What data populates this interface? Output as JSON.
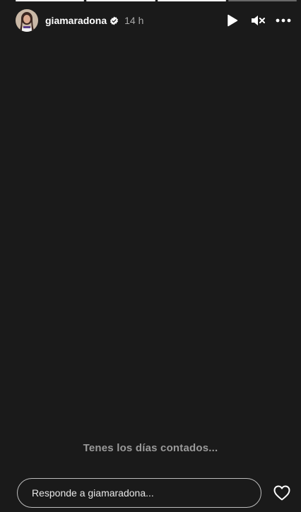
{
  "story": {
    "progress": {
      "segments_total": 4,
      "segments_done": 3
    },
    "header": {
      "username": "giamaradona",
      "time": "14 h",
      "avatar_icon": "profile-photo",
      "verified_icon": "verified-badge-icon",
      "actions": [
        "play-icon",
        "mute-icon",
        "more-icon"
      ]
    },
    "caption": "Tenes los días contados...",
    "footer": {
      "reply_placeholder": "Responde a giamaradona...",
      "like_icon": "heart-icon"
    },
    "colors": {
      "background": "#1a1a1a",
      "caption": "#9a9a9a",
      "time": "#a8a8a8"
    }
  }
}
